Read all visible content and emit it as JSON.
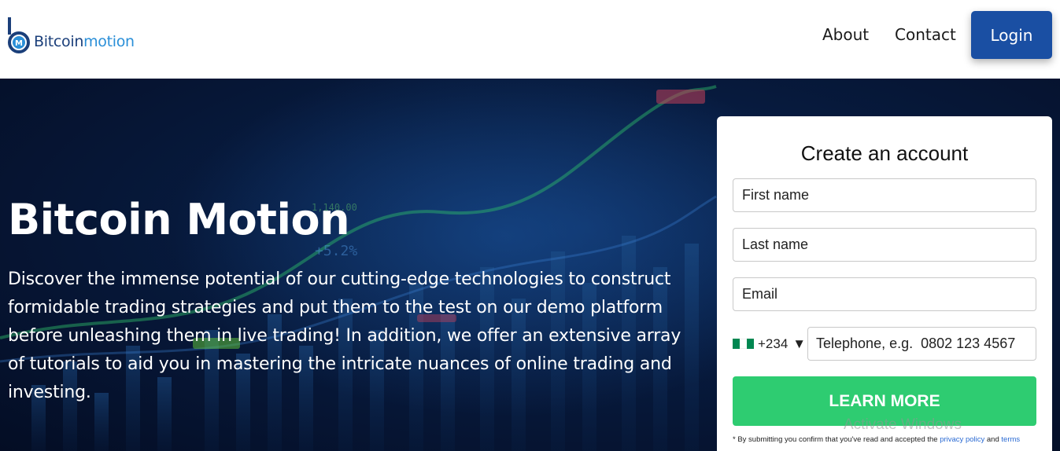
{
  "header": {
    "logo_part1": "Bitcoin",
    "logo_part2": "motion",
    "logo_badge": "M",
    "nav": {
      "about": "About",
      "contact": "Contact",
      "login": "Login"
    }
  },
  "hero": {
    "title": "Bitcoin Motion",
    "description": "Discover the immense potential of our cutting-edge technologies to construct formidable trading strategies and put them to the test on our demo platform before unleashing them in live trading! In addition, we offer an extensive array of tutorials to aid you in mastering the intricate nuances of online trading and investing.",
    "bg_labels": {
      "percent": "+5.2%",
      "ticker": "1,140.00"
    }
  },
  "form": {
    "title": "Create an account",
    "first_name_placeholder": "First name",
    "last_name_placeholder": "Last name",
    "email_placeholder": "Email",
    "country_code": "+234",
    "dropdown_arrow": "▼",
    "phone_placeholder": "Telephone, e.g.  0802 123 4567",
    "submit_label": "LEARN MORE",
    "disclaimer_prefix": "* By submitting you confirm that you've read and accepted the ",
    "privacy_link": "privacy policy",
    "disclaimer_and": " and ",
    "terms_link": "terms"
  },
  "overlay": {
    "watermark": "Activate Windows"
  },
  "colors": {
    "accent": "#1a4fa3",
    "cta": "#2ecc71",
    "hero_bg": "#071a3d",
    "flag_green": "#008751"
  }
}
